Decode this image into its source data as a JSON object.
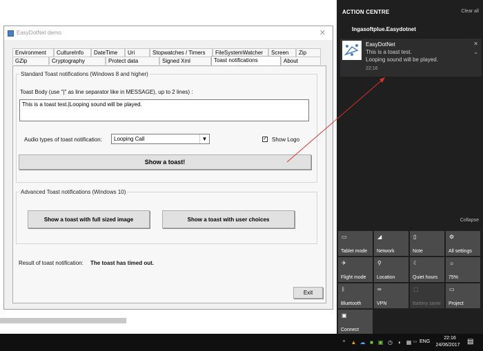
{
  "app": {
    "title": "EasyDotNet demo",
    "close_glyph": "✕",
    "tabs_row1": [
      "Environment",
      "CultureInfo",
      "DateTime",
      "Uri",
      "Stopwatches / Timers",
      "FileSystemWatcher",
      "Screen",
      "Zip"
    ],
    "tabs_row2": [
      "GZip",
      "Cryptography",
      "Protect data",
      "Signed Xml",
      "Toast notifications",
      "About"
    ],
    "active_tab": "Toast notifications",
    "standard": {
      "legend": "Standard Toast notifications (Windows 8 and higher)",
      "body_label": "Toast Body (use \"|\" as line separator like in MESSAGE), up to 2 lines) :",
      "body_value": "This is a toast test.|Looping sound will be played.",
      "audio_label": "Audio types of toast notification:",
      "audio_value": "Looping Call",
      "show_logo_label": "Show Logo",
      "show_logo_checked": "✓",
      "show_toast_button": "Show a toast!"
    },
    "advanced": {
      "legend": "Advanced Toast notifications (Windows 10)",
      "full_image_button": "Show a toast with full sized image",
      "user_choices_button": "Show a toast with user choices"
    },
    "result_label": "Result of toast notification:",
    "result_value": "The toast has timed out.",
    "exit_button": "Exit"
  },
  "action_centre": {
    "title": "ACTION CENTRE",
    "clear_all": "Clear all",
    "app_name": "Ingasoftplue.Easydotnet",
    "notification": {
      "title": "EasyDotNet",
      "line1": "This is a toast test.",
      "line2": "Looping sound will be played.",
      "time": "22:16",
      "close_glyph": "✕",
      "chevron_glyph": "⌄"
    },
    "collapse": "Collapse",
    "tiles": [
      {
        "label": "Tablet mode",
        "icon": "▭"
      },
      {
        "label": "Network",
        "icon": "◢"
      },
      {
        "label": "Note",
        "icon": "▯"
      },
      {
        "label": "All settings",
        "icon": "⚙"
      },
      {
        "label": "Flight mode",
        "icon": "✈"
      },
      {
        "label": "Location",
        "icon": "⚲"
      },
      {
        "label": "Quiet hours",
        "icon": "☾"
      },
      {
        "label": "75%",
        "icon": "☼"
      },
      {
        "label": "Bluetooth",
        "icon": "ᛒ"
      },
      {
        "label": "VPN",
        "icon": "∞"
      },
      {
        "label": "Battery saver",
        "icon": "▢"
      },
      {
        "label": "Project",
        "icon": "▭"
      },
      {
        "label": "Connect",
        "icon": "▣"
      }
    ]
  },
  "taskbar": {
    "language": "ENG",
    "time": "22:16",
    "date": "24/06/2017",
    "tray_icons": [
      "^",
      "▲",
      "☁",
      "■",
      "▣",
      "◷",
      "◐",
      "▦",
      "▭",
      "◀"
    ],
    "notification_glyph": "▤"
  }
}
